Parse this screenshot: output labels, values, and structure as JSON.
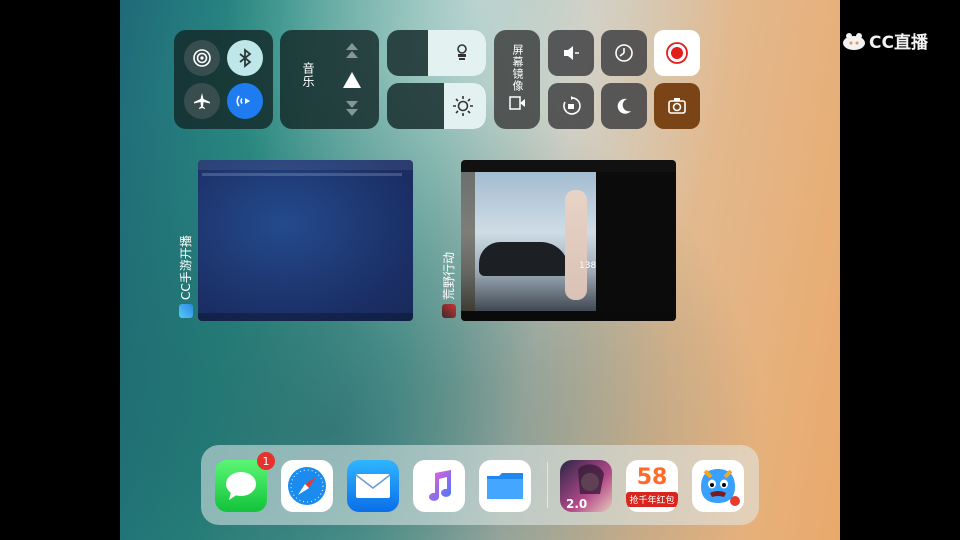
{
  "watermark": {
    "text": "CC直播"
  },
  "control_center": {
    "music_label": "音乐",
    "mirroring_label": "屏幕镜像",
    "brightness_level": 0.45,
    "volume_level": 0.45
  },
  "app_switcher": {
    "cards": [
      {
        "name": "CC手游开播"
      },
      {
        "name": "荒野行动",
        "badge_number": "138"
      }
    ]
  },
  "dock": {
    "messages_badge": "1",
    "apps": [
      "messages",
      "safari",
      "mail",
      "music",
      "files"
    ],
    "recent_apps": [
      "game",
      "58",
      "cartoon"
    ],
    "app58_label": "58",
    "app58_caption": "抢千年红包"
  }
}
